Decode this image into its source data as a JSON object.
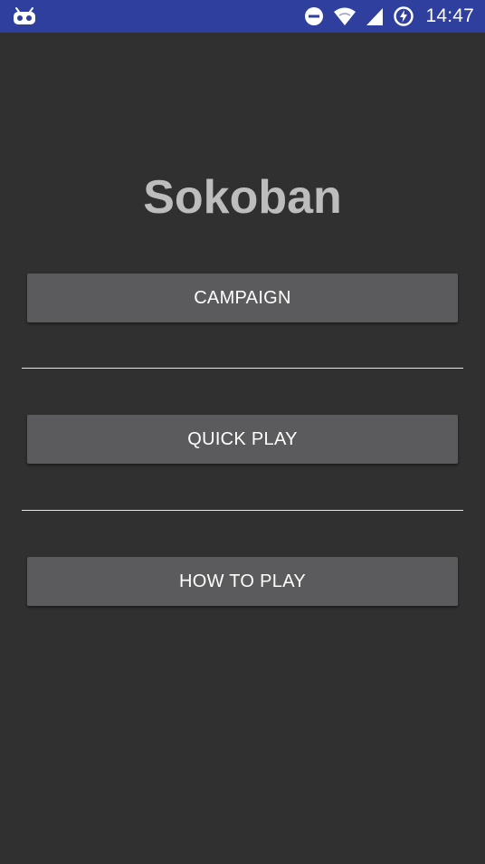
{
  "status_bar": {
    "time": "14:47",
    "background_color": "#2f3f9e",
    "icons": [
      "android-debug-icon",
      "do-not-disturb-icon",
      "wifi-icon",
      "signal-icon",
      "battery-saver-icon"
    ]
  },
  "app": {
    "title": "Sokoban",
    "buttons": {
      "campaign": "CAMPAIGN",
      "quick_play": "QUICK PLAY",
      "how_to_play": "HOW TO PLAY"
    },
    "colors": {
      "background": "#303030",
      "button": "#5b5b5d",
      "title": "#bdbdbd",
      "divider": "#e6e6e6"
    }
  }
}
